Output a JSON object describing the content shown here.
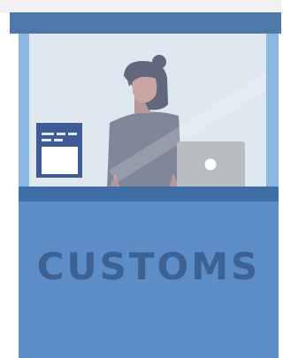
{
  "booth": {
    "sign_label": "CUSTOMS"
  },
  "colors": {
    "roof": "#4f78aa",
    "frame": "#8db7e3",
    "window": "#dfe7f0",
    "counter_top": "#3f6ea6",
    "counter_body": "#5d8dc7",
    "sign_text": "#3c6293",
    "person_body": "#7f8798",
    "person_hair": "#61687b",
    "person_skin": "#c9a5a4",
    "laptop": "#b9bdc2",
    "notice_board": "#3f5b96"
  },
  "icons": {
    "person": "person-icon",
    "laptop": "laptop-icon",
    "notice": "notice-board-icon"
  }
}
